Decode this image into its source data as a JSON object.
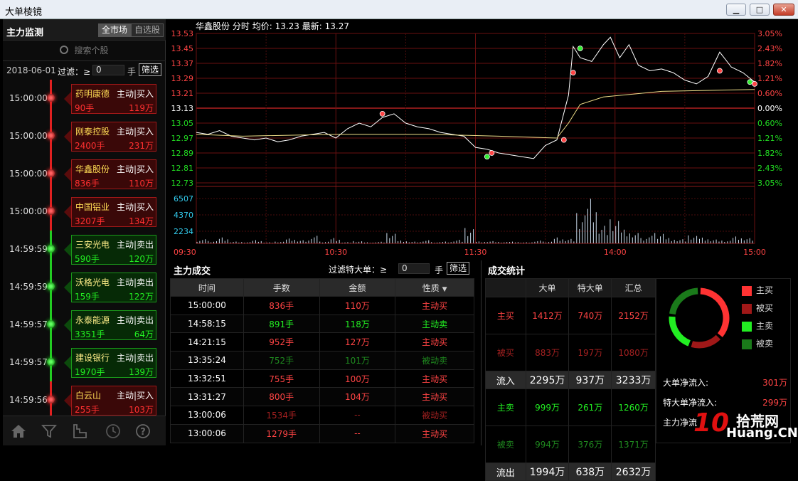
{
  "window": {
    "title": "大单棱镜",
    "min_icon": "▁",
    "max_icon": "□",
    "close_icon": "✕"
  },
  "left_panel": {
    "title": "主力监测",
    "tabs": [
      "全市场",
      "自选股"
    ],
    "search_placeholder": "搜索个股",
    "date": "2018-06-01",
    "filter_label": "过滤：≥",
    "filter_value": "0",
    "filter_unit": "手",
    "filter_button": "筛选",
    "items": [
      {
        "time": "15:00:00",
        "name": "药明康德",
        "type": "主动|买入",
        "vol": "90手",
        "amt": "119万",
        "side": "buy"
      },
      {
        "time": "15:00:00",
        "name": "刚泰控股",
        "type": "主动|买入",
        "vol": "2400手",
        "amt": "231万",
        "side": "buy"
      },
      {
        "time": "15:00:00",
        "name": "华鑫股份",
        "type": "主动|买入",
        "vol": "836手",
        "amt": "110万",
        "side": "buy"
      },
      {
        "time": "15:00:00",
        "name": "中国铝业",
        "type": "主动|买入",
        "vol": "3207手",
        "amt": "134万",
        "side": "buy"
      },
      {
        "time": "14:59:59",
        "name": "三安光电",
        "type": "主动|卖出",
        "vol": "590手",
        "amt": "120万",
        "side": "sell"
      },
      {
        "time": "14:59:59",
        "name": "沃格光电",
        "type": "主动|卖出",
        "vol": "159手",
        "amt": "122万",
        "side": "sell"
      },
      {
        "time": "14:59:57",
        "name": "永泰能源",
        "type": "主动|卖出",
        "vol": "3351手",
        "amt": "64万",
        "side": "sell"
      },
      {
        "time": "14:59:57",
        "name": "建设银行",
        "type": "主动|卖出",
        "vol": "1970手",
        "amt": "139万",
        "side": "sell"
      },
      {
        "time": "14:59:56",
        "name": "白云山",
        "type": "主动|买入",
        "vol": "255手",
        "amt": "103万",
        "side": "buy"
      }
    ],
    "footer_icons": [
      "home-icon",
      "filter-icon",
      "chart-icon",
      "clock-icon",
      "help-icon"
    ]
  },
  "chart_header": {
    "stock": "华鑫股份",
    "mode": "分时",
    "avg_label": "均价:",
    "avg": "13.23",
    "last_label": "最新:",
    "last": "13.27"
  },
  "chart_data": {
    "type": "line",
    "price_ticks": [
      "13.53",
      "13.45",
      "13.37",
      "13.29",
      "13.21",
      "13.13",
      "13.05",
      "12.97",
      "12.89",
      "12.81",
      "12.73"
    ],
    "pct_ticks": [
      "3.05%",
      "2.43%",
      "1.82%",
      "1.21%",
      "0.60%",
      "0.00%",
      "0.60%",
      "1.21%",
      "1.82%",
      "2.43%",
      "3.05%"
    ],
    "vol_ticks": [
      "6507",
      "4370",
      "2234"
    ],
    "x_ticks": [
      "09:30",
      "10:30",
      "11:30",
      "14:00",
      "15:00"
    ],
    "ylim": [
      12.73,
      13.53
    ],
    "prev_close": 13.13,
    "price": [
      [
        0,
        13.0
      ],
      [
        5,
        12.99
      ],
      [
        10,
        13.01
      ],
      [
        15,
        12.98
      ],
      [
        20,
        12.97
      ],
      [
        25,
        12.96
      ],
      [
        30,
        12.97
      ],
      [
        35,
        12.95
      ],
      [
        40,
        12.96
      ],
      [
        45,
        12.98
      ],
      [
        50,
        12.99
      ],
      [
        55,
        13.0
      ],
      [
        60,
        12.97
      ],
      [
        65,
        13.02
      ],
      [
        70,
        13.05
      ],
      [
        75,
        13.03
      ],
      [
        80,
        13.08
      ],
      [
        85,
        13.1
      ],
      [
        90,
        13.05
      ],
      [
        95,
        13.03
      ],
      [
        100,
        13.02
      ],
      [
        105,
        13.0
      ],
      [
        110,
        12.99
      ],
      [
        115,
        12.98
      ],
      [
        120,
        12.92
      ],
      [
        125,
        12.91
      ],
      [
        130,
        12.89
      ],
      [
        135,
        12.88
      ],
      [
        140,
        12.87
      ],
      [
        145,
        12.86
      ],
      [
        150,
        12.93
      ],
      [
        155,
        12.96
      ],
      [
        160,
        13.2
      ],
      [
        162,
        13.46
      ],
      [
        165,
        13.4
      ],
      [
        170,
        13.38
      ],
      [
        175,
        13.47
      ],
      [
        178,
        13.51
      ],
      [
        182,
        13.4
      ],
      [
        186,
        13.47
      ],
      [
        190,
        13.36
      ],
      [
        195,
        13.33
      ],
      [
        200,
        13.34
      ],
      [
        205,
        13.32
      ],
      [
        210,
        13.28
      ],
      [
        215,
        13.26
      ],
      [
        220,
        13.3
      ],
      [
        225,
        13.43
      ],
      [
        230,
        13.35
      ],
      [
        235,
        13.32
      ],
      [
        240,
        13.27
      ]
    ],
    "avg": [
      [
        0,
        12.99
      ],
      [
        20,
        12.98
      ],
      [
        60,
        12.99
      ],
      [
        100,
        12.99
      ],
      [
        130,
        12.98
      ],
      [
        155,
        12.97
      ],
      [
        160,
        13.05
      ],
      [
        165,
        13.15
      ],
      [
        175,
        13.19
      ],
      [
        200,
        13.22
      ],
      [
        240,
        13.23
      ]
    ],
    "volume": [
      12,
      8,
      20,
      6,
      4,
      10,
      3,
      5,
      14,
      9,
      22,
      6,
      18,
      4,
      7,
      3,
      5,
      30,
      8,
      5,
      9,
      4,
      6,
      12,
      48,
      6,
      7,
      4,
      5,
      3,
      8,
      6,
      20,
      15,
      95,
      140,
      55,
      70,
      40,
      30,
      22,
      35,
      18,
      14,
      25,
      18,
      12,
      8,
      20,
      15
    ],
    "buy_marks": [
      [
        80,
        13.1
      ],
      [
        127,
        12.89
      ],
      [
        158,
        12.96
      ],
      [
        162,
        13.32
      ],
      [
        225,
        13.33
      ],
      [
        240,
        13.26
      ]
    ],
    "sell_marks": [
      [
        125,
        12.87
      ],
      [
        165,
        13.45
      ],
      [
        238,
        13.27
      ]
    ]
  },
  "trade_panel": {
    "title": "主力成交",
    "filter_label": "过滤特大单：≥",
    "filter_value": "0",
    "filter_unit": "手",
    "filter_button": "筛选",
    "headers": [
      "时间",
      "手数",
      "金额",
      "性质"
    ],
    "sort_icon": "▼",
    "rows": [
      {
        "time": "15:00:00",
        "vol": "836手",
        "amt": "110万",
        "kind": "主动买",
        "c": "#ff4444"
      },
      {
        "time": "14:58:15",
        "vol": "891手",
        "amt": "118万",
        "kind": "主动卖",
        "c": "#22ee22"
      },
      {
        "time": "14:21:15",
        "vol": "952手",
        "amt": "127万",
        "kind": "主动买",
        "c": "#ff4444"
      },
      {
        "time": "13:35:24",
        "vol": "752手",
        "amt": "101万",
        "kind": "被动卖",
        "c": "#1f8a1f"
      },
      {
        "time": "13:32:51",
        "vol": "755手",
        "amt": "100万",
        "kind": "主动买",
        "c": "#ff4444"
      },
      {
        "time": "13:31:27",
        "vol": "800手",
        "amt": "104万",
        "kind": "主动买",
        "c": "#ff4444"
      },
      {
        "time": "13:00:06",
        "vol": "1534手",
        "amt": "--",
        "kind": "被动买",
        "c": "#a32020"
      },
      {
        "time": "13:00:06",
        "vol": "1279手",
        "amt": "--",
        "kind": "主动买",
        "c": "#ff4444"
      }
    ]
  },
  "stats_panel": {
    "title": "成交统计",
    "headers": [
      "",
      "大单",
      "特大单",
      "汇总"
    ],
    "rows": [
      {
        "label": "主买",
        "v": [
          "1412万",
          "740万",
          "2152万"
        ],
        "c": "#ff4444"
      },
      {
        "label": "被买",
        "v": [
          "883万",
          "197万",
          "1080万"
        ],
        "c": "#a32020"
      },
      {
        "label": "流入",
        "v": [
          "2295万",
          "937万",
          "3233万"
        ],
        "c": "#fff",
        "total": true
      },
      {
        "label": "主卖",
        "v": [
          "999万",
          "261万",
          "1260万"
        ],
        "c": "#22ee22"
      },
      {
        "label": "被卖",
        "v": [
          "994万",
          "376万",
          "1371万"
        ],
        "c": "#1f8a1f"
      },
      {
        "label": "流出",
        "v": [
          "1994万",
          "638万",
          "2632万"
        ],
        "c": "#fff",
        "total": true
      }
    ],
    "legend": [
      {
        "label": "主买",
        "color": "#ff3333"
      },
      {
        "label": "被买",
        "color": "#a01818"
      },
      {
        "label": "主卖",
        "color": "#22ee22"
      },
      {
        "label": "被卖",
        "color": "#1a7a1a"
      }
    ],
    "donut": [
      2152,
      1080,
      1260,
      1371
    ],
    "net": [
      {
        "label": "大单净流入:",
        "value": "301万"
      },
      {
        "label": "特大单净流入:",
        "value": "299万"
      },
      {
        "label": "主力净流",
        "value": ""
      }
    ]
  },
  "watermark": {
    "num": "10",
    "cn": "拾荒网",
    "en": "Huang.CN"
  }
}
